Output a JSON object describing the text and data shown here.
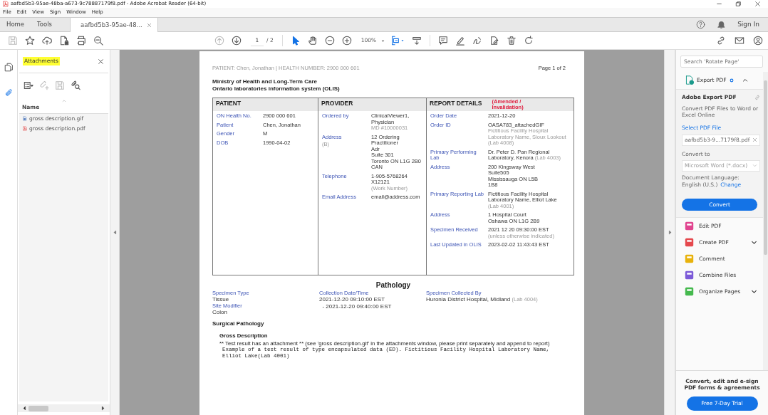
{
  "window": {
    "title": "aafbd5b3-95ae-48ba-a673-9c78887179f8.pdf - Adobe Acrobat Reader (64-bit)"
  },
  "menu": [
    "File",
    "Edit",
    "View",
    "Sign",
    "Window",
    "Help"
  ],
  "tabs": [
    {
      "label": "Home",
      "selected": false,
      "closable": false
    },
    {
      "label": "Tools",
      "selected": false,
      "closable": false
    },
    {
      "label": "aafbd5b3-95ae-48...",
      "selected": true,
      "closable": true
    }
  ],
  "account": {
    "sign_in": "Sign In"
  },
  "toolbar": {
    "file_actions": [
      {
        "kind": "save",
        "disabled": true
      },
      {
        "kind": "star",
        "disabled": false
      },
      {
        "kind": "upload",
        "disabled": false
      },
      {
        "kind": "protect",
        "disabled": false
      },
      {
        "kind": "print",
        "disabled": false
      },
      {
        "kind": "find",
        "disabled": false
      }
    ],
    "page_nav": [
      {
        "kind": "previous",
        "disabled": true
      },
      {
        "kind": "next",
        "disabled": false
      }
    ],
    "page_current": "1",
    "page_total": "/ 2",
    "pointer_tools": [
      {
        "kind": "select",
        "selected": true
      },
      {
        "kind": "hand",
        "selected": false
      }
    ],
    "zoom": "100%"
  },
  "sidebar": [
    {
      "kind": "pages",
      "selected": false
    },
    {
      "kind": "attachments",
      "selected": true
    }
  ],
  "attachments": {
    "title": "Attachments",
    "actions": [
      {
        "kind": "options",
        "disabled": false
      },
      {
        "kind": "add",
        "disabled": true
      },
      {
        "kind": "save",
        "disabled": true
      },
      {
        "kind": "search",
        "disabled": false
      }
    ],
    "column": "Name",
    "files": [
      {
        "name": "gross description.gif",
        "kind": "gif"
      },
      {
        "name": "gross description.pdf",
        "kind": "pdf"
      }
    ]
  },
  "document": {
    "running_header": "PATIENT: Chen, Jonathan | HEALTH NUMBER: 2900 000 601",
    "page_label": "Page 1 of 2",
    "titles": [
      "Ministry of Health and Long-Term Care",
      "Ontario laboratories information system (OLIS)"
    ],
    "sections": [
      {
        "title": "PATIENT",
        "fields": [
          {
            "label": "ON Health No.",
            "value": [
              "2900 000 601"
            ]
          },
          {
            "label": "Patient",
            "value": [
              "Chen, Jonathan"
            ]
          },
          {
            "label": "Gender",
            "value": [
              "M"
            ]
          },
          {
            "label": "DOB",
            "value": [
              "1990-04-02"
            ]
          }
        ]
      },
      {
        "title": "PROVIDER",
        "fields": [
          {
            "label": "Ordered by",
            "value": [
              "ClinicalViewer1,",
              "Physician"
            ],
            "note": "MD #10000031"
          },
          {
            "label": "Address",
            "label_note": "(B)",
            "value": [
              "12 Ordering Practitioner",
              "Adr",
              "Suite 301",
              "Toronto ON L1G 2B0",
              "CAN"
            ]
          },
          {
            "label": "Telephone",
            "value": [
              "1-905-5768264 X12121"
            ],
            "note": "(Work Number)"
          },
          {
            "label": "Email Address",
            "value": [
              "email@address.com"
            ]
          }
        ]
      },
      {
        "title": "REPORT DETAILS",
        "badge": "(Amended / Invalidation)",
        "fields": [
          {
            "label": "Order Date",
            "value": [
              "2021-12-20"
            ]
          },
          {
            "label": "Order ID",
            "value": [
              "OASA783_attachedGIF"
            ],
            "note": "Fictitious Facility Hospital Laboratory Name, Sioux Lookout (Lab 4008)"
          },
          {
            "label": "Primary Performing Lab",
            "value": [
              "Dr. Peter D. Pan Regional Laboratory, Kenora"
            ],
            "inline_note": "(Lab 4003)"
          },
          {
            "label": "Address",
            "value": [
              "200 Kingsway West",
              "Suite505",
              "Mississauga ON L5B",
              "1B8"
            ]
          },
          {
            "label": "Primary Reporting Lab",
            "value": [
              "Fictitious Facility Hospital Laboratory Name, Elliot Lake"
            ],
            "note": "(Lab 4001)"
          },
          {
            "label": "Address",
            "value": [
              "1 Hospital Court",
              "Oshawa ON L1G 2B9"
            ]
          },
          {
            "label": "Specimen Received",
            "value": [
              "2021 12 20 09:30:00 EST"
            ],
            "note": "(unless otherwise indicated)"
          },
          {
            "label": "Last Updated in OLIS",
            "value": [
              "2023-02-02 11:43:43 EST"
            ]
          }
        ]
      }
    ],
    "pathology": {
      "title": "Pathology",
      "columns": [
        [
          {
            "label": "Specimen Type",
            "value": [
              "Tissue"
            ]
          },
          {
            "label": "Site Modifier",
            "value": [
              "Colon"
            ]
          }
        ],
        [
          {
            "label": "Collection Date/Time",
            "value": [
              "2021-12-20 09:10:00 EST",
              "  - 2021-12-20 09:40:00 EST"
            ]
          }
        ],
        [
          {
            "label": "Specimen Collected By",
            "value": [
              "Huronia District Hospital, Midland"
            ],
            "inline_note": "(Lab 4004)"
          }
        ]
      ],
      "subtitle": "Surgical Pathology",
      "test_title": "Gross Description",
      "result": "** Test result has an attachment ** (see 'gross description.gif' in the attachments window, please print separately and append to report)",
      "encapsulated": "Example of a test result of type encapsulated data (ED). Fictitious Facility Hospital Laboratory Name, Elliot Lake(Lab 4001)"
    }
  },
  "tools_pane": {
    "search_placeholder": "Search 'Rotate Page'",
    "export": {
      "label": "Export PDF",
      "expanded": true,
      "heading": "Adobe Export PDF",
      "description": "Convert PDF Files to Word or Excel Online",
      "select_label": "Select PDF File",
      "file": "aafbd5b3-9...7179f8.pdf",
      "convert_to_label": "Convert to",
      "format": "Microsoft Word (*.docx)",
      "language_label": "Document Language:",
      "language": "English (U.S.)",
      "change": "Change",
      "button": "Convert"
    },
    "tools": [
      {
        "label": "Edit PDF",
        "color": "#e0448f",
        "dropdown": false
      },
      {
        "label": "Create PDF",
        "color": "#e5484d",
        "dropdown": true
      },
      {
        "label": "Comment",
        "color": "#e8b20c",
        "dropdown": false
      },
      {
        "label": "Combine Files",
        "color": "#7c5ad8",
        "dropdown": false
      },
      {
        "label": "Organize Pages",
        "color": "#45b94e",
        "dropdown": true
      }
    ],
    "promo": "Convert, edit and e-sign PDF forms & agreements",
    "trial": "Free 7-Day Trial"
  }
}
